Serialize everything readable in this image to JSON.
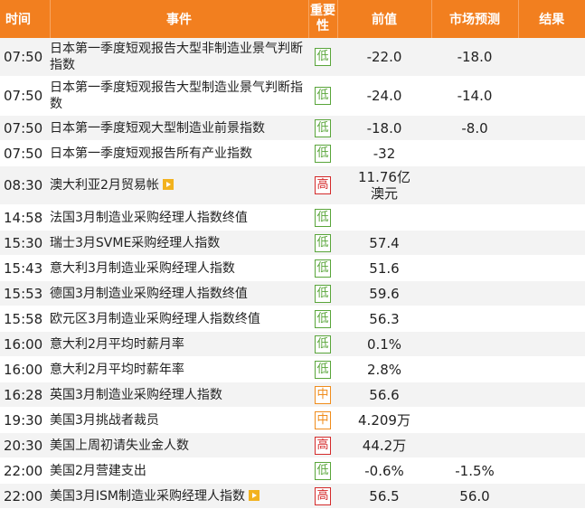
{
  "header": {
    "time": "时间",
    "event": "事件",
    "importance": "重要性",
    "previous": "前值",
    "forecast": "市场预测",
    "result": "结果"
  },
  "rows": [
    {
      "time": "07:50",
      "event": "日本第一季度短观报告大型非制造业景气判断指数",
      "importance": "低",
      "level": "low",
      "previous": "-22.0",
      "forecast": "-18.0",
      "result": "",
      "video": false
    },
    {
      "time": "07:50",
      "event": "日本第一季度短观报告大型制造业景气判断指数",
      "importance": "低",
      "level": "low",
      "previous": "-24.0",
      "forecast": "-14.0",
      "result": "",
      "video": false
    },
    {
      "time": "07:50",
      "event": "日本第一季度短观大型制造业前景指数",
      "importance": "低",
      "level": "low",
      "previous": "-18.0",
      "forecast": "-8.0",
      "result": "",
      "video": false
    },
    {
      "time": "07:50",
      "event": "日本第一季度短观报告所有产业指数",
      "importance": "低",
      "level": "low",
      "previous": "-32",
      "forecast": "",
      "result": "",
      "video": false
    },
    {
      "time": "08:30",
      "event": "澳大利亚2月贸易帐",
      "importance": "高",
      "level": "high",
      "previous": "11.76亿澳元",
      "forecast": "",
      "result": "",
      "video": true
    },
    {
      "time": "14:58",
      "event": "法国3月制造业采购经理人指数终值",
      "importance": "低",
      "level": "low",
      "previous": "",
      "forecast": "",
      "result": "",
      "video": false
    },
    {
      "time": "15:30",
      "event": "瑞士3月SVME采购经理人指数",
      "importance": "低",
      "level": "low",
      "previous": "57.4",
      "forecast": "",
      "result": "",
      "video": false
    },
    {
      "time": "15:43",
      "event": "意大利3月制造业采购经理人指数",
      "importance": "低",
      "level": "low",
      "previous": "51.6",
      "forecast": "",
      "result": "",
      "video": false
    },
    {
      "time": "15:53",
      "event": "德国3月制造业采购经理人指数终值",
      "importance": "低",
      "level": "low",
      "previous": "59.6",
      "forecast": "",
      "result": "",
      "video": false
    },
    {
      "time": "15:58",
      "event": "欧元区3月制造业采购经理人指数终值",
      "importance": "低",
      "level": "low",
      "previous": "56.3",
      "forecast": "",
      "result": "",
      "video": false
    },
    {
      "time": "16:00",
      "event": "意大利2月平均时薪月率",
      "importance": "低",
      "level": "low",
      "previous": "0.1%",
      "forecast": "",
      "result": "",
      "video": false
    },
    {
      "time": "16:00",
      "event": "意大利2月平均时薪年率",
      "importance": "低",
      "level": "low",
      "previous": "2.8%",
      "forecast": "",
      "result": "",
      "video": false
    },
    {
      "time": "16:28",
      "event": "英国3月制造业采购经理人指数",
      "importance": "中",
      "level": "mid",
      "previous": "56.6",
      "forecast": "",
      "result": "",
      "video": false
    },
    {
      "time": "19:30",
      "event": "美国3月挑战者裁员",
      "importance": "中",
      "level": "mid",
      "previous": "4.209万",
      "forecast": "",
      "result": "",
      "video": false
    },
    {
      "time": "20:30",
      "event": "美国上周初请失业金人数",
      "importance": "高",
      "level": "high",
      "previous": "44.2万",
      "forecast": "",
      "result": "",
      "video": false
    },
    {
      "time": "22:00",
      "event": "美国2月营建支出",
      "importance": "低",
      "level": "low",
      "previous": "-0.6%",
      "forecast": "-1.5%",
      "result": "",
      "video": false
    },
    {
      "time": "22:00",
      "event": "美国3月ISM制造业采购经理人指数",
      "importance": "高",
      "level": "high",
      "previous": "56.5",
      "forecast": "56.0",
      "result": "",
      "video": true
    }
  ]
}
